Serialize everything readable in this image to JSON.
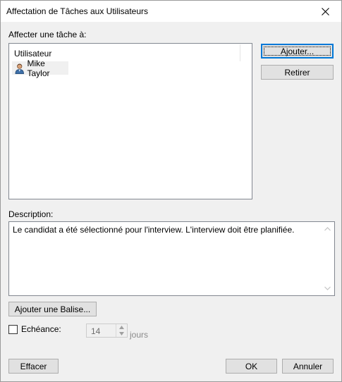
{
  "window": {
    "title": "Affectation de Tâches aux Utilisateurs"
  },
  "assign": {
    "label": "Affecter une tâche à:",
    "column_header": "Utilisateur",
    "users": [
      {
        "name": "Mike Taylor",
        "icon": "user-icon"
      }
    ]
  },
  "buttons": {
    "add": "Ajouter...",
    "remove": "Retirer",
    "add_tag": "Ajouter une Balise...",
    "clear": "Effacer",
    "ok": "OK",
    "cancel": "Annuler"
  },
  "description": {
    "label": "Description:",
    "text": "Le candidat a été sélectionné pour l'interview. L'interview doit être planifiée."
  },
  "deadline": {
    "label": "Echéance:",
    "checked": false,
    "value": "14",
    "unit": "jours"
  },
  "colors": {
    "title_bg": "#ffffff",
    "dialog_bg": "#f0f0f0",
    "button_bg": "#e1e1e1",
    "focus_border": "#0078d7"
  }
}
